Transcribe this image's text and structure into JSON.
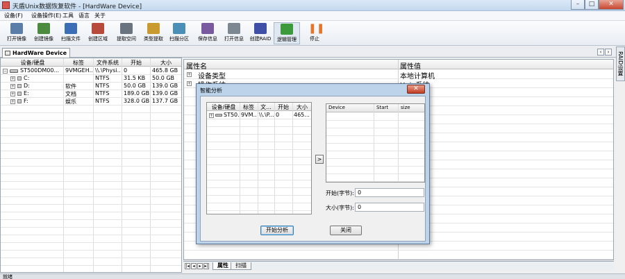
{
  "window": {
    "title": "天盾Unix数据恢复软件 - [HardWare Device]"
  },
  "menu": [
    "设备(F)",
    "设备操作(E)",
    "工具",
    "语言",
    "关于"
  ],
  "toolbar": [
    {
      "label": "打开镜像",
      "icon": "disk-open-icon",
      "color": "#5b7ea8"
    },
    {
      "label": "创建镜像",
      "icon": "create-image-icon",
      "color": "#4c8a3e"
    },
    {
      "label": "扫描文件",
      "icon": "scan-file-icon",
      "color": "#3a6fb5"
    },
    {
      "label": "创建区域",
      "icon": "create-region-icon",
      "color": "#b84a3b"
    },
    {
      "label": "提取空间",
      "icon": "extract-space-icon",
      "color": "#6a7480"
    },
    {
      "label": "类型提取",
      "icon": "type-extract-icon",
      "color": "#c99a2e"
    },
    {
      "label": "扫描分区",
      "icon": "scan-partition-icon",
      "color": "#4a8fb8"
    },
    {
      "label": "保存信息",
      "icon": "save-icon",
      "color": "#7a5a9e"
    },
    {
      "label": "打开信息",
      "icon": "open-info-icon",
      "color": "#7d8792"
    },
    {
      "label": "创建RAID",
      "icon": "raid-icon",
      "color": "#3f4fa8"
    },
    {
      "label": "逻辑管理",
      "icon": "logic-manage-icon",
      "color": "#3c9a3c"
    },
    {
      "label": "停止",
      "icon": "stop-icon",
      "color": "#e5752a"
    }
  ],
  "left_tab": {
    "label": "HardWare Device"
  },
  "device_grid": {
    "columns": [
      "设备/硬盘",
      "标签",
      "文件系统",
      "开始",
      "大小"
    ],
    "rows": [
      {
        "name": "ST500DM00...",
        "label": "9VMGEH...",
        "fs": "\\\\.\\Physi...",
        "start": "0",
        "size": "465.8 GB",
        "level": 0
      },
      {
        "name": "C:",
        "label": "",
        "fs": "NTFS",
        "start": "31.5 KB",
        "size": "50.0 GB",
        "level": 1
      },
      {
        "name": "D:",
        "label": "软件",
        "fs": "NTFS",
        "start": "50.0 GB",
        "size": "139.0 GB",
        "level": 1
      },
      {
        "name": "E:",
        "label": "文档",
        "fs": "NTFS",
        "start": "189.0 GB",
        "size": "139.0 GB",
        "level": 1
      },
      {
        "name": "F:",
        "label": "娱乐",
        "fs": "NTFS",
        "start": "328.0 GB",
        "size": "137.7 GB",
        "level": 1
      }
    ]
  },
  "property_grid": {
    "columns": [
      "属性名",
      "属性值"
    ],
    "rows": [
      {
        "name": "设备类型",
        "value": "本地计算机"
      },
      {
        "name": "操作系统",
        "value": "Unix系统"
      }
    ]
  },
  "side_tab": {
    "label": "RAID设置"
  },
  "bottom_tabs": [
    "属性",
    "扫描"
  ],
  "status": {
    "text": "就绪"
  },
  "dialog": {
    "title": "智能分析",
    "close_label": "✕",
    "grid_columns": [
      "设备/硬盘",
      "标签",
      "文...",
      "开始",
      "大小"
    ],
    "grid_row": {
      "name": "ST50...",
      "label": "9VM...",
      "fs": "\\\\.\\P...",
      "start": "0",
      "size": "465..."
    },
    "arrow_label": ">",
    "device_columns": [
      "Device",
      "Start",
      "size"
    ],
    "start_label": "开始(字节):",
    "start_value": "0",
    "size_label": "大小(字节):",
    "size_value": "0",
    "analyze_label": "开始分析",
    "close_button_label": "关闭"
  }
}
